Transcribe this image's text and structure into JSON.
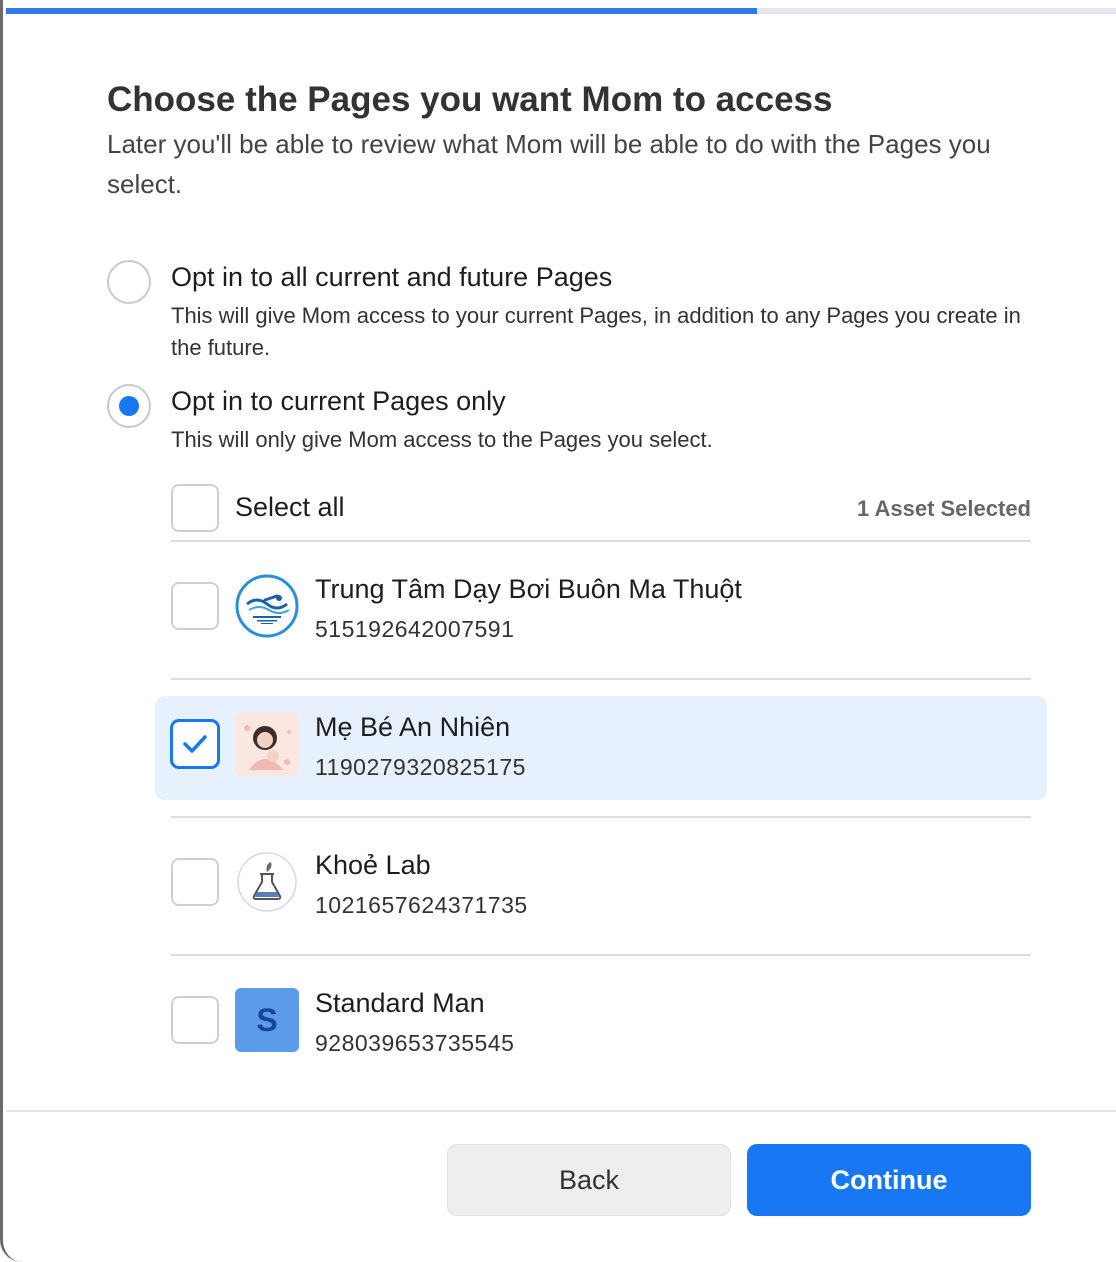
{
  "progress": {
    "value": 0.675,
    "color": "#3578e5"
  },
  "header": {
    "title": "Choose the Pages you want Mom to access",
    "subtitle": "Later you'll be able to review what Mom will be able to do with the Pages you select."
  },
  "options": [
    {
      "label": "Opt in to all current and future Pages",
      "description": "This will give Mom access to your current Pages, in addition to any Pages you create in the future.",
      "selected": false
    },
    {
      "label": "Opt in to current Pages only",
      "description": "This will only give Mom access to the Pages you select.",
      "selected": true
    }
  ],
  "list": {
    "select_all_label": "Select all",
    "asset_count": "1 Asset Selected",
    "pages": [
      {
        "name": "Trung Tâm Dạy Bơi Buôn Ma Thuột",
        "id": "515192642007591",
        "checked": false,
        "avatar": "swim-center-logo"
      },
      {
        "name": "Mẹ Bé An Nhiên",
        "id": "1190279320825175",
        "checked": true,
        "avatar": "mother-baby-illustration"
      },
      {
        "name": "Khoẻ Lab",
        "id": "1021657624371735",
        "checked": false,
        "avatar": "flask-leaf-logo"
      },
      {
        "name": "Standard Man",
        "id": "928039653735545",
        "checked": false,
        "avatar": "letter-s-avatar",
        "avatar_letter": "S"
      }
    ]
  },
  "footer": {
    "back_label": "Back",
    "continue_label": "Continue"
  },
  "colors": {
    "accent": "#1877f2",
    "selected_row": "#e7f0fd"
  }
}
